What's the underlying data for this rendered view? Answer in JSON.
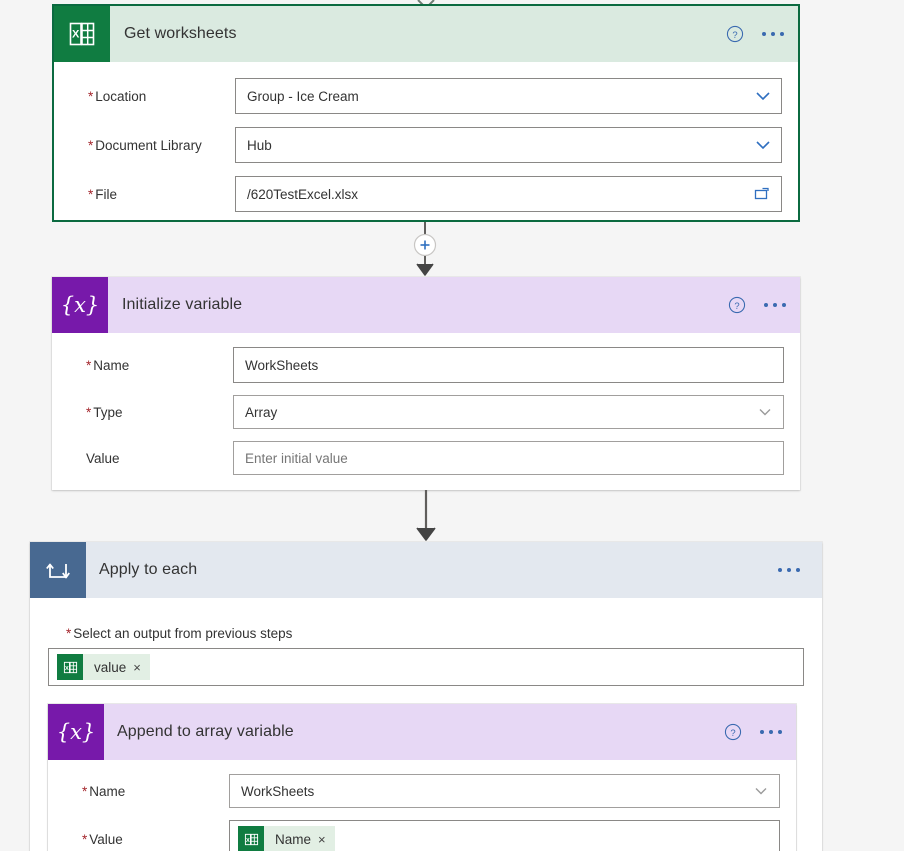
{
  "flow": {
    "steps": [
      {
        "id": "get-worksheets",
        "title": "Get worksheets",
        "icon": "excel-icon",
        "accent": "#107c41",
        "fields": [
          {
            "label": "Location",
            "required": true,
            "value": "Group - Ice Cream",
            "control": "dropdown"
          },
          {
            "label": "Document Library",
            "required": true,
            "value": "Hub",
            "control": "dropdown"
          },
          {
            "label": "File",
            "required": true,
            "value": "/620TestExcel.xlsx",
            "control": "file-picker"
          }
        ]
      },
      {
        "id": "initialize-variable",
        "title": "Initialize variable",
        "icon": "variable-icon",
        "accent": "#7719aa",
        "icon_glyph": "{x}",
        "fields": [
          {
            "label": "Name",
            "required": true,
            "value": "WorkSheets",
            "control": "text"
          },
          {
            "label": "Type",
            "required": true,
            "value": "Array",
            "control": "dropdown"
          },
          {
            "label": "Value",
            "required": false,
            "value": "",
            "placeholder": "Enter initial value",
            "control": "text"
          }
        ]
      },
      {
        "id": "apply-to-each",
        "title": "Apply to each",
        "icon": "loop-icon",
        "accent": "#486991",
        "output_label": "Select an output from previous steps",
        "output_required": true,
        "output_token": {
          "text": "value",
          "icon": "excel-icon",
          "remove": "×"
        },
        "child": {
          "id": "append-to-array-variable",
          "title": "Append to array variable",
          "icon": "variable-icon",
          "accent": "#7719aa",
          "icon_glyph": "{x}",
          "fields": [
            {
              "label": "Name",
              "required": true,
              "value": "WorkSheets",
              "control": "dropdown"
            },
            {
              "label": "Value",
              "required": true,
              "token": {
                "text": "Name",
                "icon": "excel-icon",
                "remove": "×"
              },
              "control": "token"
            }
          ]
        }
      }
    ],
    "connectors": [
      {
        "id": "connector-top",
        "type": "arrow"
      },
      {
        "id": "connector-add-step",
        "type": "add-arrow",
        "label": "+"
      },
      {
        "id": "connector-to-loop",
        "type": "arrow"
      }
    ],
    "colors": {
      "background": "#f5f5f5",
      "excel_green": "#107c41",
      "variable_purple": "#7719aa",
      "loop_blue": "#486991",
      "selected_border": "#0b6a40",
      "required_red": "#a4262c",
      "action_blue": "#3a6ab0"
    }
  }
}
